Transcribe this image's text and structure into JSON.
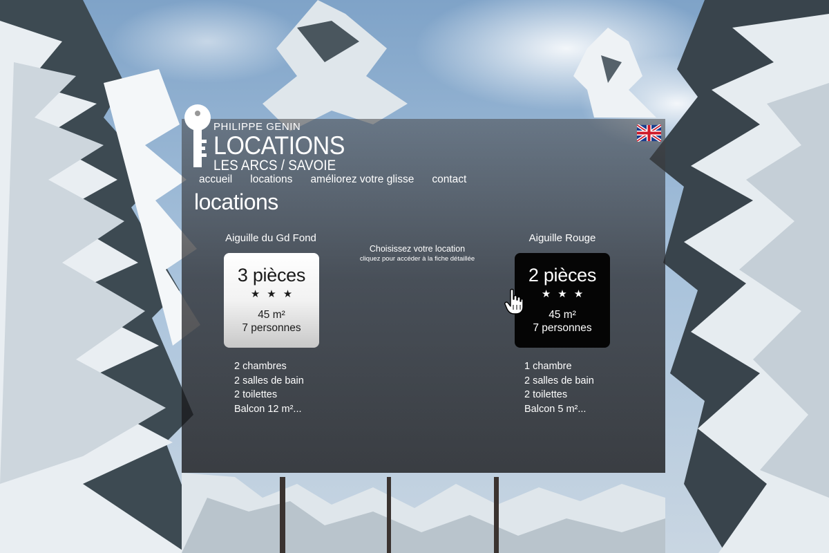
{
  "logo": {
    "line1": "PHILIPPE GENIN",
    "line2": "LOCATIONS",
    "line3": "LES ARCS / SAVOIE",
    "icon": "key-icon"
  },
  "language_flag": {
    "icon": "uk-flag-icon"
  },
  "nav": [
    "accueil",
    "locations",
    "améliorez votre glisse",
    "contact"
  ],
  "page": {
    "title": "locations"
  },
  "center": {
    "main": "Choisissez votre location",
    "sub": "cliquez pour accéder à la fiche détaillée"
  },
  "listings": [
    {
      "name": "Aiguille du Gd Fond",
      "rooms": "3 pièces",
      "stars": "★★★",
      "area": "45 m²",
      "people": "7 personnes",
      "features": [
        "2 chambres",
        "2 salles de bain",
        "2 toilettes",
        "Balcon 12 m²..."
      ]
    },
    {
      "name": "Aiguille Rouge",
      "rooms": "2 pièces",
      "stars": "★★★",
      "area": "45 m²",
      "people": "7 personnes",
      "features": [
        "1 chambre",
        "2 salles de bain",
        "2 toilettes",
        "Balcon 5 m²..."
      ]
    }
  ],
  "colors": {
    "sky": "#8fb0cf",
    "card_light": "#f2f2f2",
    "card_dark": "#050505",
    "text": "#ffffff"
  }
}
